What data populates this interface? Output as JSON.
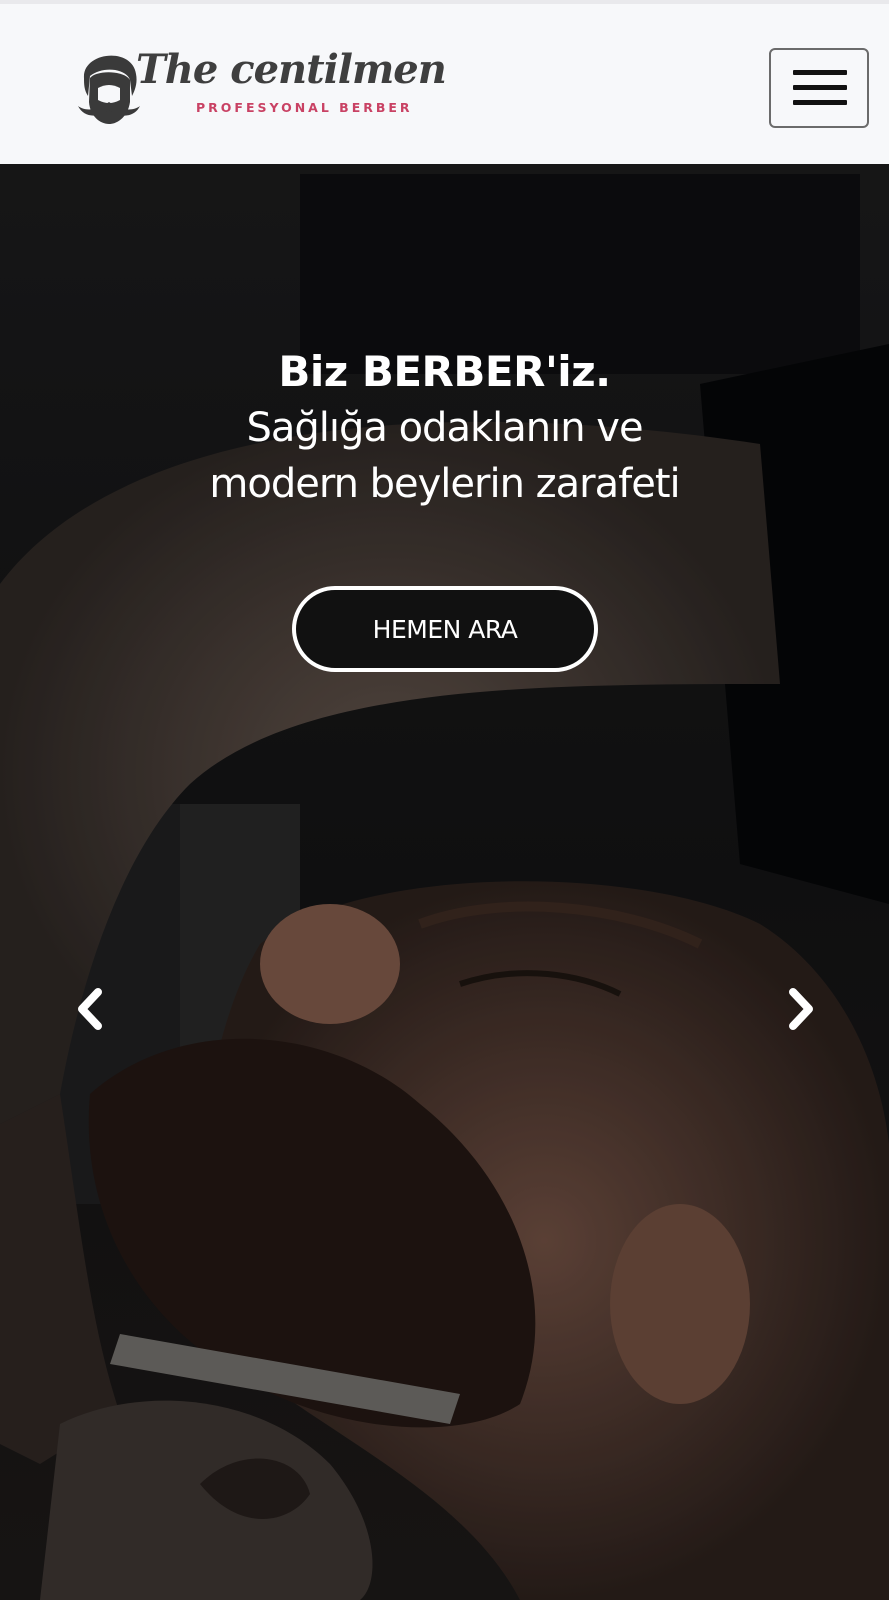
{
  "navbar": {
    "brand_name": "The centilmen",
    "brand_tagline": "PROFESYONAL BERBER",
    "menu_toggle_icon": "hamburger-menu-icon"
  },
  "hero": {
    "headline": "Biz BERBER'iz.",
    "subline_1": "Sağlığa odaklanın ve",
    "subline_2": "modern beylerin zarafeti",
    "cta_label": "HEMEN ARA",
    "prev_icon": "chevron-left-icon",
    "next_icon": "chevron-right-icon"
  },
  "colors": {
    "brand_accent": "#c94264",
    "navbar_bg": "#f7f8fa",
    "cta_bg": "#111111"
  }
}
